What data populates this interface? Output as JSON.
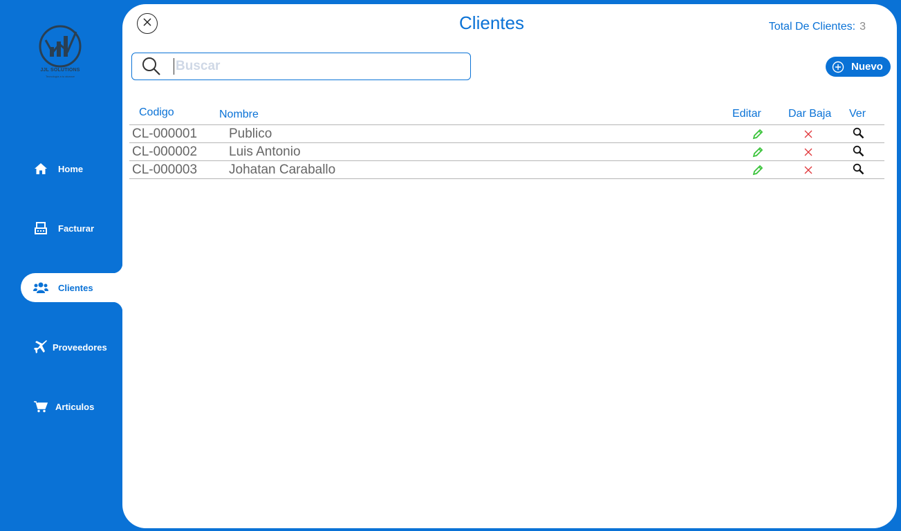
{
  "brand": {
    "logo_text": "JJL SOLUTIONS",
    "logo_sub": "Tecnología a tu alcance"
  },
  "colors": {
    "accent": "#0a72d6",
    "edit": "#3cc43c",
    "delete": "#e0363a"
  },
  "sidebar": {
    "items": [
      {
        "label": "Home",
        "icon": "home-icon"
      },
      {
        "label": "Facturar",
        "icon": "register-icon"
      },
      {
        "label": "Clientes",
        "icon": "users-icon",
        "active": true
      },
      {
        "label": "Proveedores",
        "icon": "plane-icon"
      },
      {
        "label": "Articulos",
        "icon": "cart-icon"
      }
    ]
  },
  "header": {
    "title": "Clientes",
    "total_label": "Total De Clientes:",
    "total_value": "3"
  },
  "search": {
    "placeholder": "Buscar",
    "value": ""
  },
  "toolbar": {
    "new_label": "Nuevo"
  },
  "table": {
    "columns": {
      "codigo": "Codigo",
      "nombre": "Nombre",
      "editar": "Editar",
      "baja": "Dar Baja",
      "ver": "Ver"
    },
    "rows": [
      {
        "codigo": "CL-000001",
        "nombre": "Publico"
      },
      {
        "codigo": "CL-000002",
        "nombre": "Luis Antonio"
      },
      {
        "codigo": "CL-000003",
        "nombre": "Johatan Caraballo"
      }
    ]
  }
}
